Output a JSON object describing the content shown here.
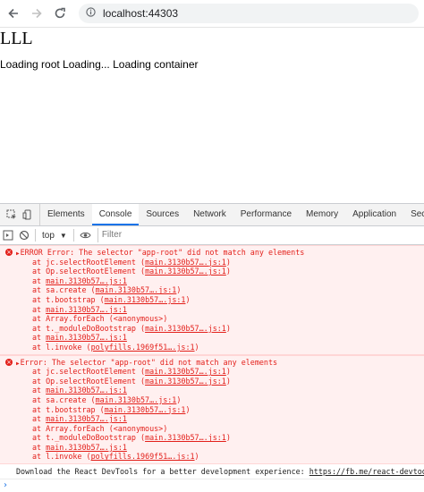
{
  "browser": {
    "url": "localhost:44303"
  },
  "page": {
    "heading": "LLL",
    "loading_text": "Loading root Loading... Loading container"
  },
  "devtools": {
    "tabs": [
      {
        "label": "Elements"
      },
      {
        "label": "Console"
      },
      {
        "label": "Sources"
      },
      {
        "label": "Network"
      },
      {
        "label": "Performance"
      },
      {
        "label": "Memory"
      },
      {
        "label": "Application"
      },
      {
        "label": "Security"
      }
    ],
    "active_tab": "Console",
    "context": "top",
    "filter_placeholder": "Filter",
    "errors": [
      {
        "message": "ERROR Error: The selector \"app-root\" did not match any elements",
        "stack": [
          {
            "text": "at jc.selectRootElement (",
            "link": "main.3130b57….js:1",
            "end": ")"
          },
          {
            "text": "at Op.selectRootElement (",
            "link": "main.3130b57….js:1",
            "end": ")"
          },
          {
            "text": "at ",
            "link": "main.3130b57….js:1",
            "end": ""
          },
          {
            "text": "at sa.create (",
            "link": "main.3130b57….js:1",
            "end": ")"
          },
          {
            "text": "at t.bootstrap (",
            "link": "main.3130b57….js:1",
            "end": ")"
          },
          {
            "text": "at ",
            "link": "main.3130b57….js:1",
            "end": ""
          },
          {
            "text": "at Array.forEach (<anonymous>)",
            "link": "",
            "end": ""
          },
          {
            "text": "at t._moduleDoBootstrap (",
            "link": "main.3130b57….js:1",
            "end": ")"
          },
          {
            "text": "at ",
            "link": "main.3130b57….js:1",
            "end": ""
          },
          {
            "text": "at l.invoke (",
            "link": "polyfills.1969f51….js:1",
            "end": ")"
          }
        ]
      },
      {
        "message": "Error: The selector \"app-root\" did not match any elements",
        "stack": [
          {
            "text": "at jc.selectRootElement (",
            "link": "main.3130b57….js:1",
            "end": ")"
          },
          {
            "text": "at Op.selectRootElement (",
            "link": "main.3130b57….js:1",
            "end": ")"
          },
          {
            "text": "at ",
            "link": "main.3130b57….js:1",
            "end": ""
          },
          {
            "text": "at sa.create (",
            "link": "main.3130b57….js:1",
            "end": ")"
          },
          {
            "text": "at t.bootstrap (",
            "link": "main.3130b57….js:1",
            "end": ")"
          },
          {
            "text": "at ",
            "link": "main.3130b57….js:1",
            "end": ""
          },
          {
            "text": "at Array.forEach (<anonymous>)",
            "link": "",
            "end": ""
          },
          {
            "text": "at t._moduleDoBootstrap (",
            "link": "main.3130b57….js:1",
            "end": ")"
          },
          {
            "text": "at ",
            "link": "main.3130b57….js:1",
            "end": ""
          },
          {
            "text": "at l.invoke (",
            "link": "polyfills.1969f51….js:1",
            "end": ")"
          }
        ]
      }
    ],
    "info": {
      "text": "Download the React DevTools for a better development experience: ",
      "link": "https://fb.me/react-devtools"
    },
    "prompt_symbol": "›"
  },
  "colors": {
    "error_text": "#e3201b",
    "error_bg": "#fff0f0",
    "active_tab_underline": "#1a73e8"
  }
}
